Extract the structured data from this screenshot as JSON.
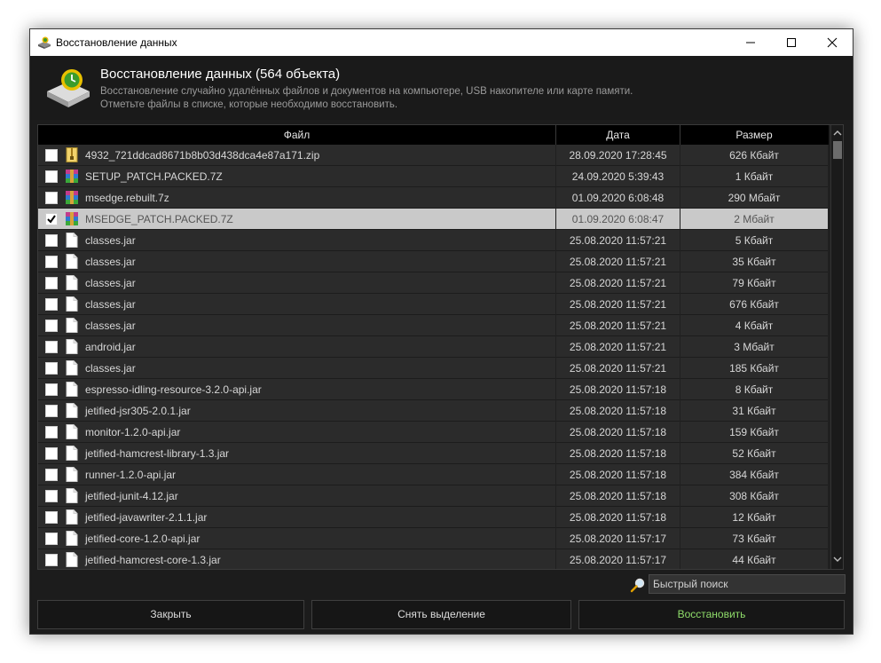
{
  "window": {
    "title": "Восстановление данных",
    "app_icon": "disk-recovery-icon"
  },
  "header": {
    "title": "Восстановление данных (564 объекта)",
    "description_line1": "Восстановление случайно удалённых файлов и документов на компьютере, USB накопителе или карте памяти.",
    "description_line2": "Отметьте файлы в списке, которые необходимо восстановить.",
    "icon": "hard-drive-recovery-icon"
  },
  "table": {
    "columns": {
      "file": "Файл",
      "date": "Дата",
      "size": "Размер"
    },
    "rows": [
      {
        "name": "4932_721ddcad8671b8b03d438dca4e87a171.zip",
        "date": "28.09.2020 17:28:45",
        "size": "626 Кбайт",
        "icon": "zip",
        "checked": false,
        "selected": false
      },
      {
        "name": "SETUP_PATCH.PACKED.7Z",
        "date": "24.09.2020 5:39:43",
        "size": "1 Кбайт",
        "icon": "archive",
        "checked": false,
        "selected": false
      },
      {
        "name": "msedge.rebuilt.7z",
        "date": "01.09.2020 6:08:48",
        "size": "290 Мбайт",
        "icon": "archive",
        "checked": false,
        "selected": false
      },
      {
        "name": "MSEDGE_PATCH.PACKED.7Z",
        "date": "01.09.2020 6:08:47",
        "size": "2 Мбайт",
        "icon": "archive",
        "checked": true,
        "selected": true
      },
      {
        "name": "classes.jar",
        "date": "25.08.2020 11:57:21",
        "size": "5 Кбайт",
        "icon": "file",
        "checked": false,
        "selected": false
      },
      {
        "name": "classes.jar",
        "date": "25.08.2020 11:57:21",
        "size": "35 Кбайт",
        "icon": "file",
        "checked": false,
        "selected": false
      },
      {
        "name": "classes.jar",
        "date": "25.08.2020 11:57:21",
        "size": "79 Кбайт",
        "icon": "file",
        "checked": false,
        "selected": false
      },
      {
        "name": "classes.jar",
        "date": "25.08.2020 11:57:21",
        "size": "676 Кбайт",
        "icon": "file",
        "checked": false,
        "selected": false
      },
      {
        "name": "classes.jar",
        "date": "25.08.2020 11:57:21",
        "size": "4 Кбайт",
        "icon": "file",
        "checked": false,
        "selected": false
      },
      {
        "name": "android.jar",
        "date": "25.08.2020 11:57:21",
        "size": "3 Мбайт",
        "icon": "file",
        "checked": false,
        "selected": false
      },
      {
        "name": "classes.jar",
        "date": "25.08.2020 11:57:21",
        "size": "185 Кбайт",
        "icon": "file",
        "checked": false,
        "selected": false
      },
      {
        "name": "espresso-idling-resource-3.2.0-api.jar",
        "date": "25.08.2020 11:57:18",
        "size": "8 Кбайт",
        "icon": "file",
        "checked": false,
        "selected": false
      },
      {
        "name": "jetified-jsr305-2.0.1.jar",
        "date": "25.08.2020 11:57:18",
        "size": "31 Кбайт",
        "icon": "file",
        "checked": false,
        "selected": false
      },
      {
        "name": "monitor-1.2.0-api.jar",
        "date": "25.08.2020 11:57:18",
        "size": "159 Кбайт",
        "icon": "file",
        "checked": false,
        "selected": false
      },
      {
        "name": "jetified-hamcrest-library-1.3.jar",
        "date": "25.08.2020 11:57:18",
        "size": "52 Кбайт",
        "icon": "file",
        "checked": false,
        "selected": false
      },
      {
        "name": "runner-1.2.0-api.jar",
        "date": "25.08.2020 11:57:18",
        "size": "384 Кбайт",
        "icon": "file",
        "checked": false,
        "selected": false
      },
      {
        "name": "jetified-junit-4.12.jar",
        "date": "25.08.2020 11:57:18",
        "size": "308 Кбайт",
        "icon": "file",
        "checked": false,
        "selected": false
      },
      {
        "name": "jetified-javawriter-2.1.1.jar",
        "date": "25.08.2020 11:57:18",
        "size": "12 Кбайт",
        "icon": "file",
        "checked": false,
        "selected": false
      },
      {
        "name": "jetified-core-1.2.0-api.jar",
        "date": "25.08.2020 11:57:17",
        "size": "73 Кбайт",
        "icon": "file",
        "checked": false,
        "selected": false
      },
      {
        "name": "jetified-hamcrest-core-1.3.jar",
        "date": "25.08.2020 11:57:17",
        "size": "44 Кбайт",
        "icon": "file",
        "checked": false,
        "selected": false
      }
    ]
  },
  "search": {
    "placeholder": "Быстрый поиск",
    "value": ""
  },
  "buttons": {
    "close": "Закрыть",
    "deselect": "Снять выделение",
    "restore": "Восстановить"
  },
  "colors": {
    "background": "#1c1c1c",
    "row": "#2b2b2b",
    "selected_row": "#c9c9c9",
    "restore_text": "#8fdc6a"
  }
}
